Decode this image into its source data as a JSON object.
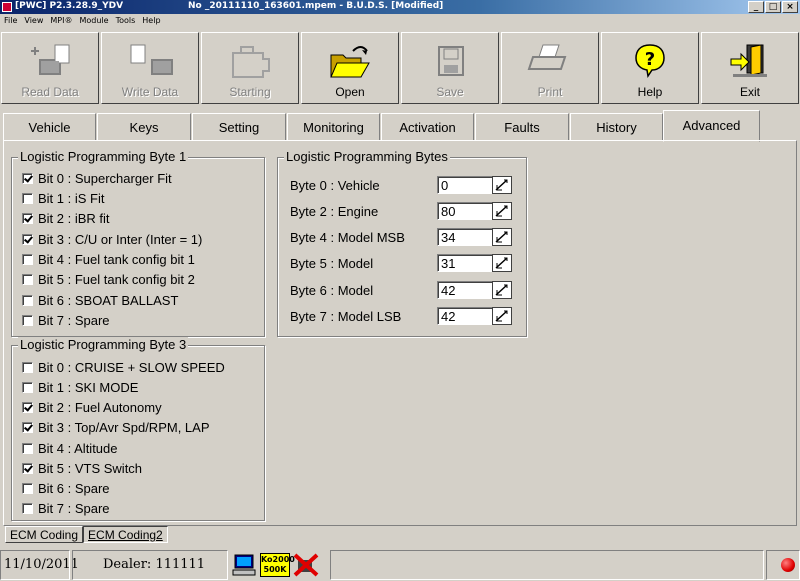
{
  "window": {
    "app_title": "[PWC] P2.3.28.9_YDV",
    "doc_title": "No _20111110_163601.mpem - B.U.D.S. [Modified]",
    "controls": [
      "_",
      "□",
      "×"
    ]
  },
  "menu": [
    "File",
    "View",
    "MPI®",
    "Module",
    "Tools",
    "Help"
  ],
  "toolbar": [
    {
      "label": "Read Data",
      "icon": "read-data-icon",
      "enabled": false
    },
    {
      "label": "Write Data",
      "icon": "write-data-icon",
      "enabled": false
    },
    {
      "label": "Starting",
      "icon": "engine-icon",
      "enabled": false
    },
    {
      "label": "Open",
      "icon": "folder-open-icon",
      "enabled": true
    },
    {
      "label": "Save",
      "icon": "floppy-icon",
      "enabled": false
    },
    {
      "label": "Print",
      "icon": "printer-icon",
      "enabled": false
    },
    {
      "label": "Help",
      "icon": "help-icon",
      "enabled": true
    },
    {
      "label": "Exit",
      "icon": "exit-door-icon",
      "enabled": true
    }
  ],
  "tabs": [
    {
      "label": "Vehicle",
      "active": false
    },
    {
      "label": "Keys",
      "active": false
    },
    {
      "label": "Setting",
      "active": false
    },
    {
      "label": "Monitoring",
      "active": false
    },
    {
      "label": "Activation",
      "active": false
    },
    {
      "label": "Faults",
      "active": false
    },
    {
      "label": "History",
      "active": false
    },
    {
      "label": "Advanced",
      "active": true
    }
  ],
  "byte1": {
    "title": "Logistic Programming Byte 1",
    "bits": [
      {
        "label": "Bit 0 : Supercharger Fit",
        "checked": true
      },
      {
        "label": "Bit 1 : iS Fit",
        "checked": false
      },
      {
        "label": "Bit 2 : iBR fit",
        "checked": true
      },
      {
        "label": "Bit 3 : C/U or Inter (Inter = 1)",
        "checked": true
      },
      {
        "label": "Bit 4 : Fuel tank config bit 1",
        "checked": false
      },
      {
        "label": "Bit 5 : Fuel tank config bit 2",
        "checked": false
      },
      {
        "label": "Bit 6 : SBOAT BALLAST",
        "checked": false
      },
      {
        "label": "Bit 7 : Spare",
        "checked": false
      }
    ]
  },
  "byte3": {
    "title": "Logistic Programming Byte 3",
    "bits": [
      {
        "label": "Bit 0 : CRUISE + SLOW SPEED",
        "checked": false
      },
      {
        "label": "Bit 1 : SKI MODE",
        "checked": false
      },
      {
        "label": "Bit 2 : Fuel Autonomy",
        "checked": true
      },
      {
        "label": "Bit 3 : Top/Avr Spd/RPM, LAP",
        "checked": true
      },
      {
        "label": "Bit 4 : Altitude",
        "checked": false
      },
      {
        "label": "Bit 5 : VTS Switch",
        "checked": true
      },
      {
        "label": "Bit 6 : Spare",
        "checked": false
      },
      {
        "label": "Bit 7 : Spare",
        "checked": false
      }
    ]
  },
  "bytes": {
    "title": "Logistic Programming Bytes",
    "rows": [
      {
        "label": "Byte 0 : Vehicle",
        "value": "0"
      },
      {
        "label": "Byte 2 : Engine",
        "value": "80"
      },
      {
        "label": "Byte 4 : Model MSB",
        "value": "34"
      },
      {
        "label": "Byte 5 : Model",
        "value": "31"
      },
      {
        "label": "Byte 6 : Model",
        "value": "42"
      },
      {
        "label": "Byte 7 : Model LSB",
        "value": "42"
      }
    ]
  },
  "bottom_tabs": [
    {
      "label": "ECM Coding",
      "selected": false
    },
    {
      "label": "ECM Coding2",
      "selected": true
    }
  ],
  "status": {
    "date": "11/10/2011",
    "dealer": "Dealer: 111111",
    "badge_line1": "Ko2000",
    "badge_line2": "500K",
    "indicator_color": "#e00000"
  }
}
